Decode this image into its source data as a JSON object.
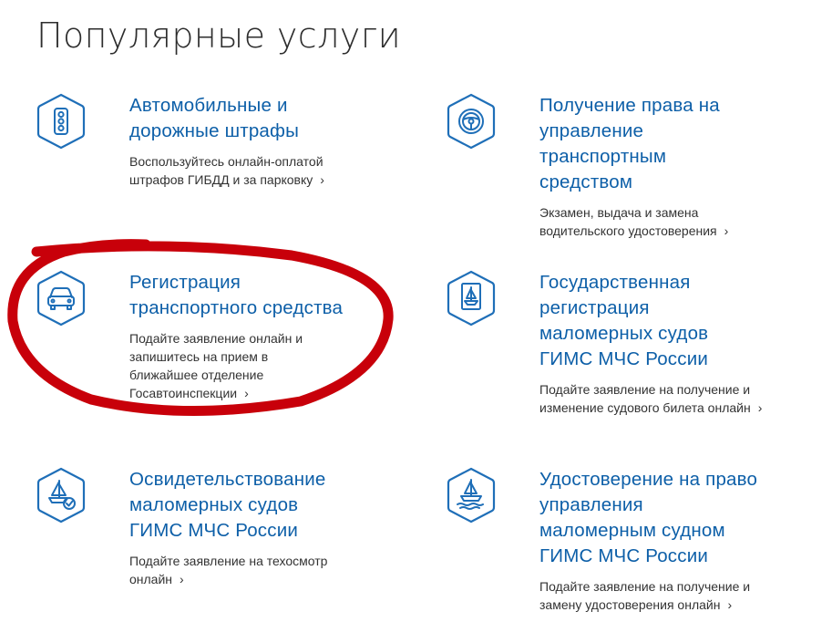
{
  "page": {
    "title": "Популярные услуги"
  },
  "services": [
    {
      "icon": "traffic-light-icon",
      "title": "Автомобильные и дорожные штрафы",
      "description": "Воспользуйтесь онлайн-оплатой штрафов ГИБДД и за парковку"
    },
    {
      "icon": "steering-wheel-icon",
      "title": "Получение права на управление транспортным средством",
      "description": "Экзамен, выдача и замена водительского удостоверения"
    },
    {
      "icon": "car-icon",
      "title": "Регистрация транспортного средства",
      "description": "Подайте заявление онлайн и запишитесь на прием в ближайшее отделение Госавтоинспекции"
    },
    {
      "icon": "boat-document-icon",
      "title": "Государственная регистрация маломерных судов ГИМС МЧС России",
      "description": "Подайте заявление на получение и изменение судового билета онлайн"
    },
    {
      "icon": "boat-check-icon",
      "title": "Освидетельствование маломерных судов ГИМС МЧС России",
      "description": "Подайте заявление на техосмотр онлайн"
    },
    {
      "icon": "boat-waves-icon",
      "title": "Удостоверение на право управления маломерным судном ГИМС МЧС России",
      "description": "Подайте заявление на получение и замену удостоверения онлайн"
    }
  ],
  "chevron_glyph": "›",
  "colors": {
    "link": "#0d5fa8",
    "icon": "#1f6fb8",
    "annotation": "#c8000a"
  }
}
